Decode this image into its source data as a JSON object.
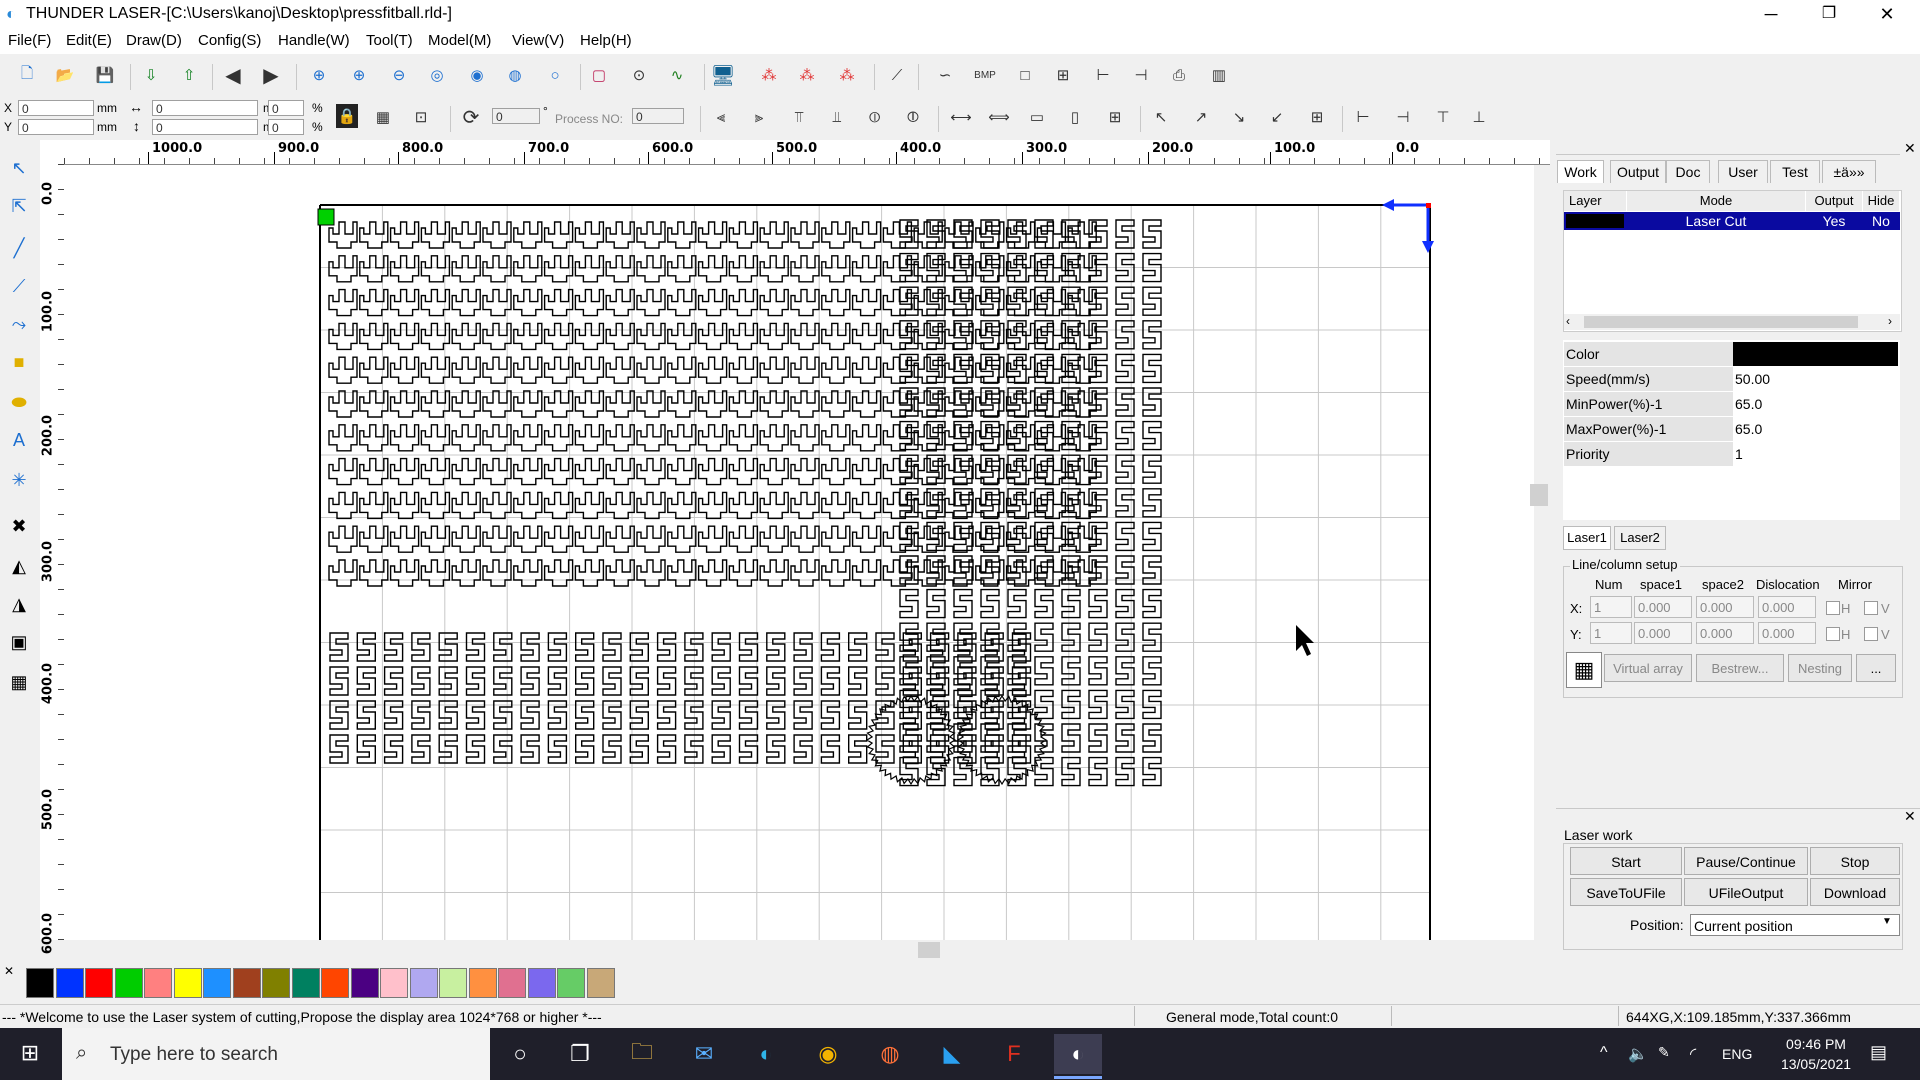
{
  "window": {
    "title": "THUNDER LASER-[C:\\Users\\kanoj\\Desktop\\pressfitball.rld-]",
    "minimize_glyph": "─",
    "restore_glyph": "❐",
    "close_glyph": "✕"
  },
  "menu": [
    "File(F)",
    "Edit(E)",
    "Draw(D)",
    "Config(S)",
    "Handle(W)",
    "Tool(T)",
    "Model(M)",
    "View(V)",
    "Help(H)"
  ],
  "toolbar2": {
    "x_label": "X",
    "y_label": "Y",
    "x_value": "0",
    "y_value": "0",
    "unit": "mm",
    "width_value": "0",
    "height_value": "0",
    "pct_w": "0",
    "pct_h": "0",
    "pct": "%",
    "rotate_value": "0",
    "degree": "°",
    "process_label": "Process NO:",
    "process_value": "0"
  },
  "ruler": {
    "h_labels": [
      "1000.0",
      "900.0",
      "800.0",
      "700.0",
      "600.0",
      "500.0",
      "400.0",
      "300.0",
      "200.0",
      "100.0",
      "0.0"
    ],
    "v_labels": [
      "0.0",
      "100.0",
      "200.0",
      "300.0",
      "400.0",
      "500.0",
      "600.0"
    ]
  },
  "panel": {
    "tabs": [
      "Work",
      "Output",
      "Doc",
      "User",
      "Test",
      "±ä»»"
    ],
    "layer_headers": [
      "Layer",
      "Mode",
      "Output",
      "Hide"
    ],
    "layer_row": {
      "mode": "Laser Cut",
      "output": "Yes",
      "hide": "No",
      "color": "#000000"
    },
    "props": [
      {
        "label": "Color",
        "value": ""
      },
      {
        "label": "Speed(mm/s)",
        "value": "50.00"
      },
      {
        "label": "MinPower(%)-1",
        "value": "65.0"
      },
      {
        "label": "MaxPower(%)-1",
        "value": "65.0"
      },
      {
        "label": "Priority",
        "value": "1"
      }
    ],
    "laser_tabs": [
      "Laser1",
      "Laser2"
    ],
    "line_column": {
      "title": "Line/column setup",
      "headers": [
        "Num",
        "space1",
        "space2",
        "Dislocation",
        "Mirror"
      ],
      "x": {
        "label": "X:",
        "num": "1",
        "space1": "0.000",
        "space2": "0.000",
        "dislocation": "0.000"
      },
      "y": {
        "label": "Y:",
        "num": "1",
        "space1": "0.000",
        "space2": "0.000",
        "dislocation": "0.000"
      },
      "h": "H",
      "v": "V",
      "buttons": [
        "Virtual array",
        "Bestrew...",
        "Nesting",
        "..."
      ]
    },
    "laser_work": {
      "title": "Laser work",
      "buttons_row1": [
        "Start",
        "Pause/Continue",
        "Stop"
      ],
      "buttons_row2": [
        "SaveToUFile",
        "UFileOutput",
        "Download"
      ],
      "position_label": "Position:",
      "position_value": "Current position"
    }
  },
  "palette": [
    "#000000",
    "#0033ff",
    "#ff0000",
    "#00cc00",
    "#ff8080",
    "#ffff00",
    "#1e90ff",
    "#a0401e",
    "#808000",
    "#008060",
    "#ff4500",
    "#4b0082",
    "#ffc0cb",
    "#b0a8f0",
    "#c8f0a0",
    "#ff9040",
    "#e07090",
    "#7b68ee",
    "#66cc66",
    "#c8a878"
  ],
  "status": {
    "message": "--- *Welcome to use the Laser system of cutting,Propose the display area 1024*768 or higher *---",
    "mode": "General mode,Total count:0",
    "coords": "644XG,X:109.185mm,Y:337.366mm"
  },
  "taskbar": {
    "search_placeholder": "Type here to search",
    "lang": "ENG",
    "time": "09:46 PM",
    "date": "13/05/2021"
  },
  "icons": {
    "start": "windows-start-icon",
    "search": "search-icon"
  }
}
